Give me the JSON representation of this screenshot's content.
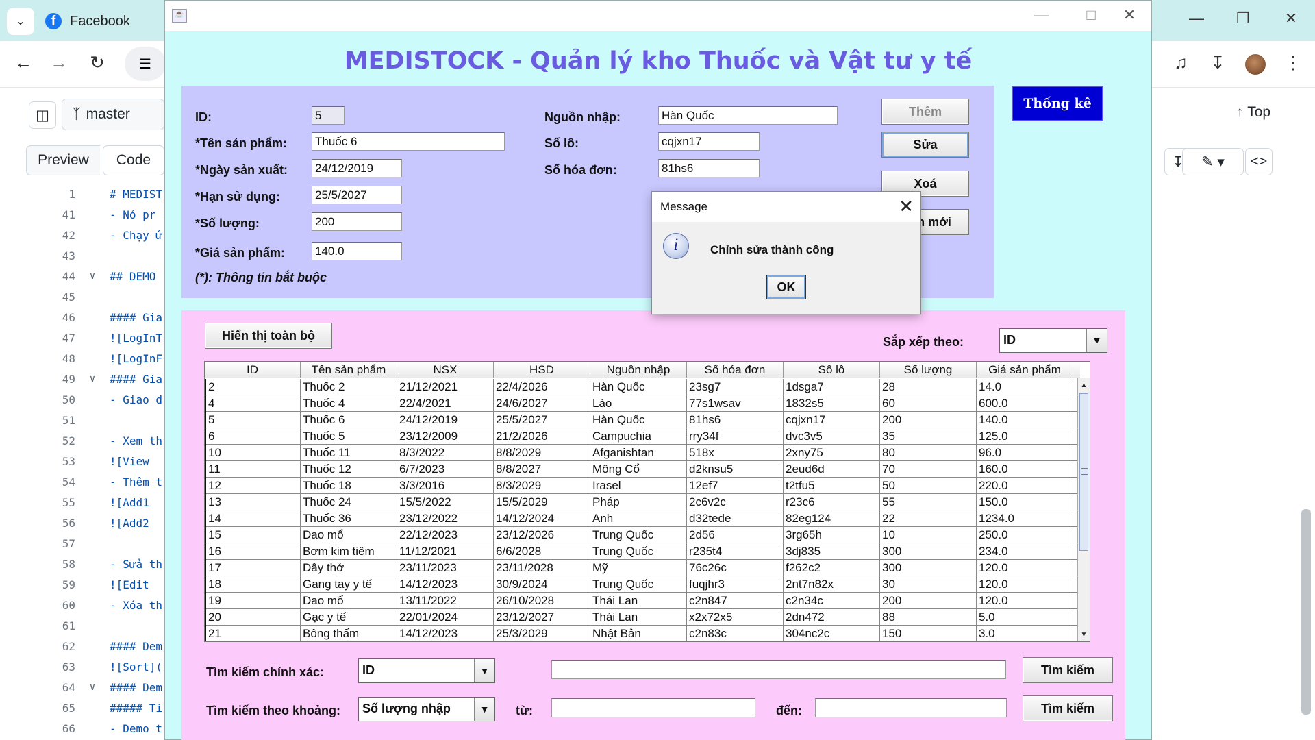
{
  "browser": {
    "tab_title": "Facebook",
    "github": {
      "branch": "master",
      "view_tabs": [
        "Preview",
        "Code"
      ],
      "top_label": "Top",
      "lines": [
        {
          "n": "1",
          "text": "# MEDIST"
        },
        {
          "n": "41",
          "text": "  - Nó pr"
        },
        {
          "n": "42",
          "text": "- Chạy ứ"
        },
        {
          "n": "43",
          "text": ""
        },
        {
          "n": "44",
          "text": "## DEMO"
        },
        {
          "n": "45",
          "text": ""
        },
        {
          "n": "46",
          "text": "#### Gia"
        },
        {
          "n": "47",
          "text": "![LogInT"
        },
        {
          "n": "48",
          "text": "![LogInF"
        },
        {
          "n": "49",
          "text": "#### Gia"
        },
        {
          "n": "50",
          "text": "- Giao d"
        },
        {
          "n": "51",
          "text": ""
        },
        {
          "n": "52",
          "text": "- Xem th"
        },
        {
          "n": "53",
          "text": "  ![View"
        },
        {
          "n": "54",
          "text": "- Thêm t"
        },
        {
          "n": "55",
          "text": "  ![Add1"
        },
        {
          "n": "56",
          "text": "  ![Add2"
        },
        {
          "n": "57",
          "text": ""
        },
        {
          "n": "58",
          "text": "- Sửa th"
        },
        {
          "n": "59",
          "text": "  ![Edit"
        },
        {
          "n": "60",
          "text": "- Xóa th"
        },
        {
          "n": "61",
          "text": ""
        },
        {
          "n": "62",
          "text": "#### Dem"
        },
        {
          "n": "63",
          "text": "![Sort]("
        },
        {
          "n": "64",
          "text": "#### Dem"
        },
        {
          "n": "65",
          "text": "##### Ti"
        },
        {
          "n": "66",
          "text": "- Demo t"
        }
      ]
    }
  },
  "app": {
    "title": "MEDISTOCK - Quản lý kho Thuốc và Vật tư y tế",
    "form": {
      "id_label": "ID:",
      "id_value": "5",
      "name_label": "*Tên sản phẩm:",
      "name_value": "Thuốc 6",
      "mfg_label": "*Ngày sản xuất:",
      "mfg_value": "24/12/2019",
      "exp_label": "*Hạn sử dụng:",
      "exp_value": "25/5/2027",
      "qty_label": "*Số lượng:",
      "qty_value": "200",
      "price_label": "*Giá sản phẩm:",
      "price_value": "140.0",
      "source_label": "Nguồn nhập:",
      "source_value": "Hàn Quốc",
      "lot_label": "Số lô:",
      "lot_value": "cqjxn17",
      "invoice_label": "Số hóa đơn:",
      "invoice_value": "81hs6",
      "required_note": "(*): Thông tin bắt buộc"
    },
    "buttons": {
      "add": "Thêm",
      "edit": "Sửa",
      "delete": "Xoá",
      "reset": "Làm mới",
      "stats": "Thống kê",
      "show_all": "Hiển thị toàn bộ"
    },
    "sort": {
      "label": "Sắp xếp theo:",
      "selected": "ID"
    },
    "table": {
      "columns": [
        "ID",
        "Tên sản phẩm",
        "NSX",
        "HSD",
        "Nguồn nhập",
        "Số hóa đơn",
        "Số lô",
        "Số lượng",
        "Giá sản phẩm"
      ],
      "rows": [
        [
          "2",
          "Thuốc 2",
          "21/12/2021",
          "22/4/2026",
          "Hàn Quốc",
          "23sg7",
          "1dsga7",
          "28",
          "14.0"
        ],
        [
          "4",
          "Thuốc 4",
          "22/4/2021",
          "24/6/2027",
          "Lào",
          "77s1wsav",
          "1832s5",
          "60",
          "600.0"
        ],
        [
          "5",
          "Thuốc 6",
          "24/12/2019",
          "25/5/2027",
          "Hàn Quốc",
          "81hs6",
          "cqjxn17",
          "200",
          "140.0"
        ],
        [
          "6",
          "Thuốc 5",
          "23/12/2009",
          "21/2/2026",
          "Campuchia",
          "rry34f",
          "dvc3v5",
          "35",
          "125.0"
        ],
        [
          "10",
          "Thuốc 11",
          "8/3/2022",
          "8/8/2029",
          "Afganishtan",
          "518x",
          "2xny75",
          "80",
          "96.0"
        ],
        [
          "11",
          "Thuốc 12",
          "6/7/2023",
          "8/8/2027",
          "Mông Cổ",
          "d2knsu5",
          "2eud6d",
          "70",
          "160.0"
        ],
        [
          "12",
          "Thuốc 18",
          "3/3/2016",
          "8/3/2029",
          "Irasel",
          "12ef7",
          "t2tfu5",
          "50",
          "220.0"
        ],
        [
          "13",
          "Thuốc 24",
          "15/5/2022",
          "15/5/2029",
          "Pháp",
          "2c6v2c",
          "r23c6",
          "55",
          "150.0"
        ],
        [
          "14",
          "Thuốc 36",
          "23/12/2022",
          "14/12/2024",
          "Anh",
          "d32tede",
          "82eg124",
          "22",
          "1234.0"
        ],
        [
          "15",
          "Dao mổ",
          "22/12/2023",
          "23/12/2026",
          "Trung Quốc",
          "2d56",
          "3rg65h",
          "10",
          "250.0"
        ],
        [
          "16",
          "Bơm kim tiêm",
          "11/12/2021",
          "6/6/2028",
          "Trung Quốc",
          "r235t4",
          "3dj835",
          "300",
          "234.0"
        ],
        [
          "17",
          "Dây thở",
          "23/11/2023",
          "23/11/2028",
          "Mỹ",
          "76c26c",
          "f262c2",
          "300",
          "120.0"
        ],
        [
          "18",
          "Gang tay y tế",
          "14/12/2023",
          "30/9/2024",
          "Trung Quốc",
          "fuqjhr3",
          "2nt7n82x",
          "30",
          "120.0"
        ],
        [
          "19",
          "Dao mổ",
          "13/11/2022",
          "26/10/2028",
          "Thái Lan",
          "c2n847",
          "c2n34c",
          "200",
          "120.0"
        ],
        [
          "20",
          "Gạc y tế",
          "22/01/2024",
          "23/12/2027",
          "Thái Lan",
          "x2x72x5",
          "2dn472",
          "88",
          "5.0"
        ],
        [
          "21",
          "Bông thấm",
          "14/12/2023",
          "25/3/2029",
          "Nhật Bản",
          "c2n83c",
          "304nc2c",
          "150",
          "3.0"
        ]
      ]
    },
    "search": {
      "exact_label": "Tìm kiếm chính xác:",
      "exact_field": "ID",
      "exact_value": "",
      "range_label": "Tìm kiếm theo khoảng:",
      "range_field": "Số lượng nhập",
      "from_label": "từ:",
      "to_label": "đến:",
      "button": "Tìm kiếm"
    },
    "dialog": {
      "title": "Message",
      "message": "Chỉnh sửa thành công",
      "ok": "OK"
    }
  }
}
